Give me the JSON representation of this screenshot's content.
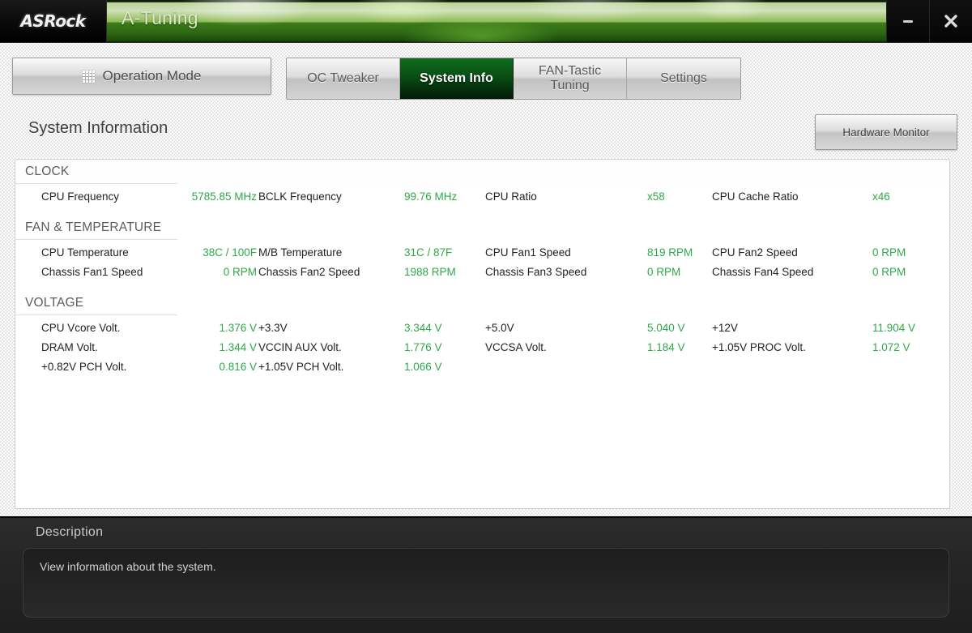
{
  "window": {
    "brand": "ASRock",
    "title": "A-Tuning",
    "minimize_label": "minimize",
    "close_label": "close"
  },
  "toolbar": {
    "operation_mode_label": "Operation Mode",
    "operation_mode_icon": "grid-icon"
  },
  "tabs": [
    {
      "label": "OC Tweaker",
      "active": false
    },
    {
      "label": "System Info",
      "active": true
    },
    {
      "label": "FAN-Tastic Tuning",
      "active": false
    },
    {
      "label": "Settings",
      "active": false
    }
  ],
  "header": {
    "page_title": "System Information",
    "hardware_monitor_label": "Hardware Monitor"
  },
  "sections": [
    {
      "title": "CLOCK",
      "rows": [
        [
          {
            "label": "CPU Frequency",
            "value": "5785.85 MHz"
          },
          {
            "label": "BCLK Frequency",
            "value": "99.76 MHz"
          },
          {
            "label": "CPU Ratio",
            "value": "x58"
          },
          {
            "label": "CPU Cache Ratio",
            "value": "x46"
          }
        ]
      ]
    },
    {
      "title": "FAN & TEMPERATURE",
      "rows": [
        [
          {
            "label": "CPU Temperature",
            "value": "38C / 100F"
          },
          {
            "label": "M/B Temperature",
            "value": "31C / 87F"
          },
          {
            "label": "CPU Fan1 Speed",
            "value": "819 RPM"
          },
          {
            "label": "CPU Fan2 Speed",
            "value": "0 RPM"
          }
        ],
        [
          {
            "label": "Chassis Fan1 Speed",
            "value": "0 RPM"
          },
          {
            "label": "Chassis Fan2 Speed",
            "value": "1988 RPM"
          },
          {
            "label": "Chassis Fan3 Speed",
            "value": "0 RPM"
          },
          {
            "label": "Chassis Fan4 Speed",
            "value": "0 RPM"
          }
        ]
      ]
    },
    {
      "title": "VOLTAGE",
      "rows": [
        [
          {
            "label": "CPU Vcore Volt.",
            "value": "1.376 V"
          },
          {
            "label": "+3.3V",
            "value": "3.344 V"
          },
          {
            "label": "+5.0V",
            "value": "5.040 V"
          },
          {
            "label": "+12V",
            "value": "11.904 V"
          }
        ],
        [
          {
            "label": "DRAM Volt.",
            "value": "1.344 V"
          },
          {
            "label": "VCCIN AUX Volt.",
            "value": "1.776 V"
          },
          {
            "label": "VCCSA Volt.",
            "value": "1.184 V"
          },
          {
            "label": "+1.05V PROC Volt.",
            "value": "1.072 V"
          }
        ],
        [
          {
            "label": "+0.82V PCH Volt.",
            "value": "0.816 V"
          },
          {
            "label": "+1.05V PCH Volt.",
            "value": "1.066 V"
          },
          {
            "label": "",
            "value": ""
          },
          {
            "label": "",
            "value": ""
          }
        ]
      ]
    }
  ],
  "description": {
    "title": "Description",
    "text": "View information about the system."
  },
  "colors": {
    "value_green": "#2ea94a",
    "active_tab_green": "#0a4d15",
    "titlebar_green": "#8cba52"
  }
}
